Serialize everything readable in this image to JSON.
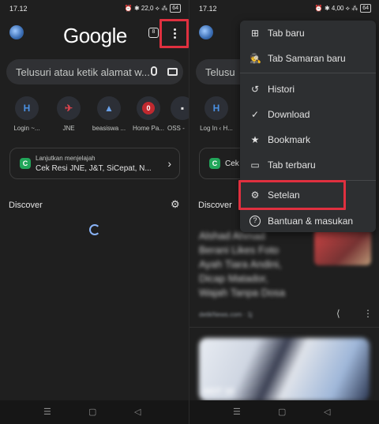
{
  "status": {
    "time": "17.12",
    "left_icons": "⏰ ✱ 22,0 ⟡ ⁂",
    "right_icons": "⏰ ✱ 4,00 ⟡ ⁂",
    "battery": "64"
  },
  "left": {
    "logo": "Google",
    "tab_count": "8",
    "search_placeholder": "Telusuri atau ketik alamat w...",
    "tiles": [
      {
        "label": "Login ~...",
        "glyph": "H",
        "color": "#4a90e2"
      },
      {
        "label": "JNE",
        "glyph": "✈",
        "color": "#d9434d"
      },
      {
        "label": "beasiswa ...",
        "glyph": "▲",
        "color": "#6aa0e8"
      },
      {
        "label": "Home Pa...",
        "glyph": "0",
        "color": "#c0292f"
      },
      {
        "label": "OSS -",
        "glyph": "▪",
        "color": "#e0e0e0"
      }
    ],
    "resume": {
      "caption": "Lanjutkan menjelajah",
      "title": "Cek Resi JNE, J&T, SiCepat, N...",
      "icon": "C"
    },
    "discover": "Discover"
  },
  "right": {
    "tile_label": "Log In ‹ H...",
    "resume_title": "Cek Re",
    "search_placeholder": "Telusu",
    "discover": "Discover",
    "feed": {
      "lines": [
        "Alshad Ahmad",
        "Berani Likes Foto",
        "Ayah Tiara Andini,",
        "Dicap Matador,",
        "Wajah Tanpa Dosa"
      ],
      "meta": "detikNews.com · 1j",
      "banner": "HOT 10"
    }
  },
  "menu": {
    "items": [
      {
        "label": "Tab baru",
        "icon": "⊞"
      },
      {
        "label": "Tab Samaran baru",
        "icon": "🕵"
      },
      {
        "label": "Histori",
        "icon": "↺"
      },
      {
        "label": "Download",
        "icon": "✓"
      },
      {
        "label": "Bookmark",
        "icon": "★"
      },
      {
        "label": "Tab terbaru",
        "icon": "▭"
      },
      {
        "label": "Setelan",
        "icon": "⚙"
      },
      {
        "label": "Bantuan & masukan",
        "icon": "?"
      }
    ]
  },
  "colors": {
    "background": "#1f1f1f",
    "highlight": "#e0303f",
    "menu_bg": "#2d2f31"
  }
}
